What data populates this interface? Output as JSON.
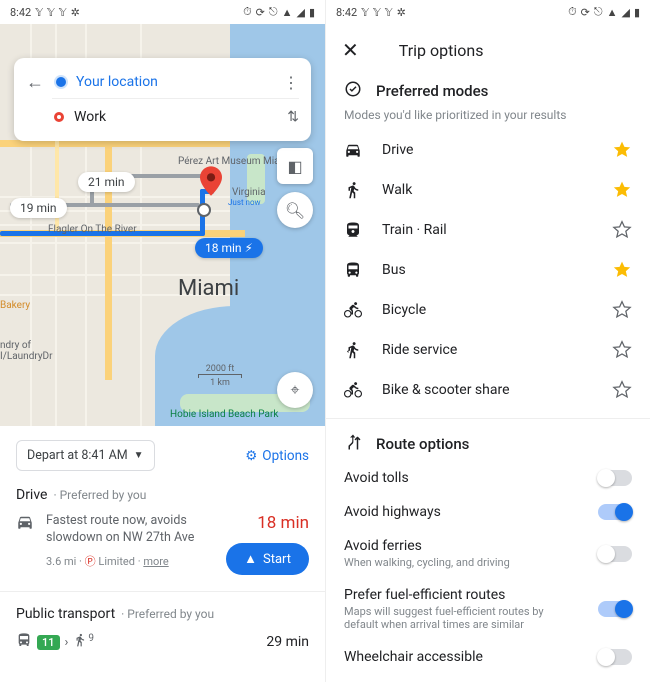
{
  "status": {
    "time": "8:42",
    "icons_left": [
      "twitter",
      "twitter",
      "twitter",
      "fan"
    ]
  },
  "left": {
    "search": {
      "from": "Your location",
      "to": "Work"
    },
    "map": {
      "city": "Miami",
      "poi": {
        "museum": "Pérez Art Museum Miami",
        "virginia": "Virginia",
        "justnow": "Just now",
        "flagler": "Flagler On The River",
        "bakery": "Bakery",
        "laundry": "ndry of\nI/LaundryDr",
        "hobie": "Hobie Island Beach Park",
        "scale_top": "2000 ft",
        "scale_bottom": "1 km"
      },
      "times": {
        "alt1": "21 min",
        "alt2": "19 min",
        "best": "18 min"
      }
    },
    "sheet": {
      "depart": "Depart at 8:41 AM",
      "options": "Options",
      "drive_title": "Drive",
      "preferred": "Preferred by you",
      "drive_time": "18 min",
      "drive_desc": "Fastest route now, avoids slowdown on NW 27th Ave",
      "drive_dist": "3.6 mi",
      "drive_parking": "Limited",
      "more": "more",
      "start": "Start",
      "pt_title": "Public transport",
      "pt_line": "11",
      "pt_walk": "9",
      "pt_time": "29 min"
    }
  },
  "right": {
    "title": "Trip options",
    "preferred_head": "Preferred modes",
    "preferred_desc": "Modes you'd like prioritized in your results",
    "modes": [
      {
        "icon": "car",
        "label": "Drive",
        "starred": true
      },
      {
        "icon": "walk",
        "label": "Walk",
        "starred": true
      },
      {
        "icon": "train",
        "label": "Train · Rail",
        "starred": false
      },
      {
        "icon": "bus",
        "label": "Bus",
        "starred": true
      },
      {
        "icon": "bike",
        "label": "Bicycle",
        "starred": false
      },
      {
        "icon": "ride",
        "label": "Ride service",
        "starred": false
      },
      {
        "icon": "scooter",
        "label": "Bike & scooter share",
        "starred": false
      }
    ],
    "route_head": "Route options",
    "route_opts": [
      {
        "label": "Avoid tolls",
        "desc": "",
        "on": false
      },
      {
        "label": "Avoid highways",
        "desc": "",
        "on": true
      },
      {
        "label": "Avoid ferries",
        "desc": "When walking, cycling, and driving",
        "on": false
      },
      {
        "label": "Prefer fuel-efficient routes",
        "desc": "Maps will suggest fuel-efficient routes by default when arrival times are similar",
        "on": true
      },
      {
        "label": "Wheelchair accessible",
        "desc": "",
        "on": false
      }
    ]
  }
}
